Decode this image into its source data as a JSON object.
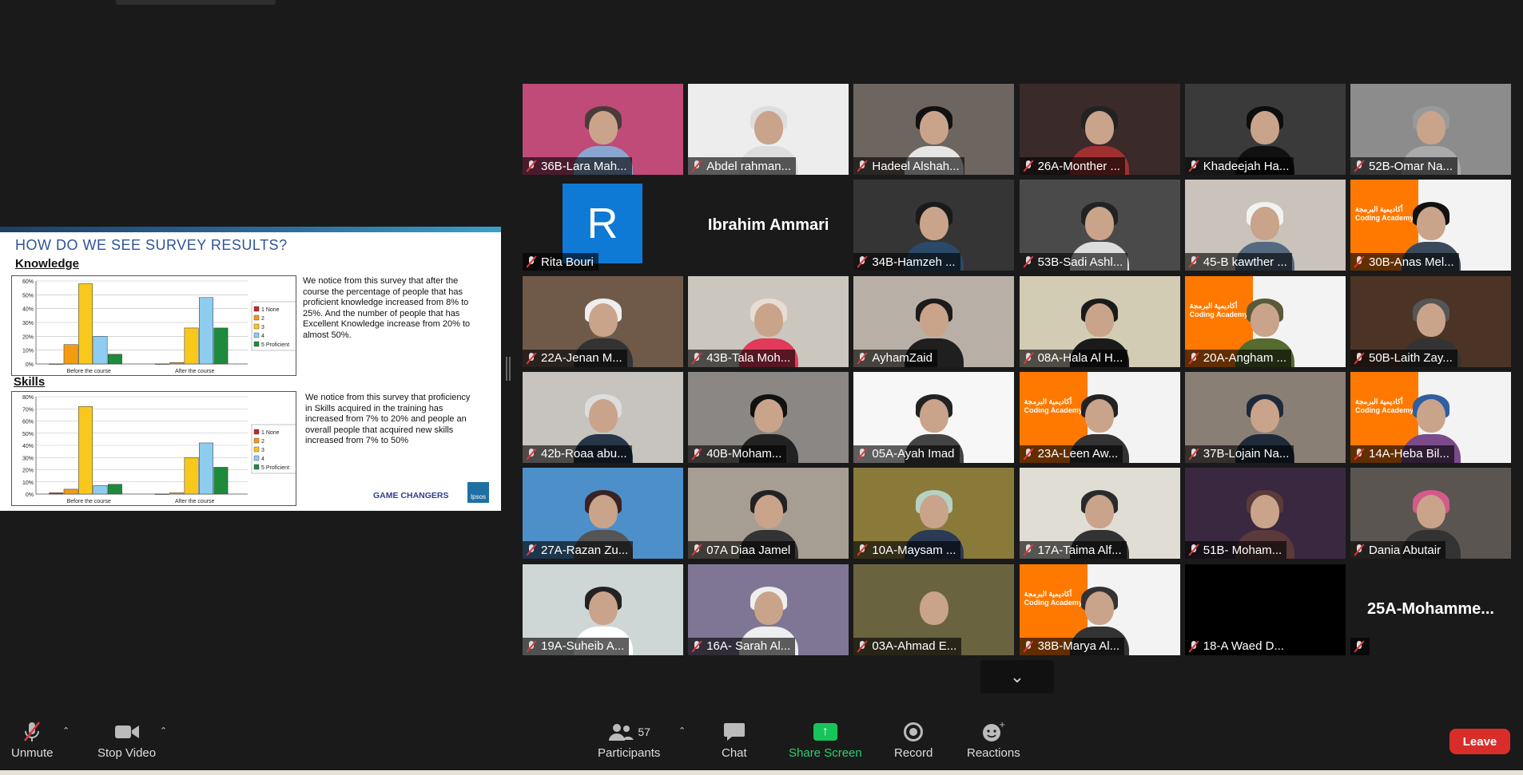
{
  "slide": {
    "title": "HOW DO WE SEE SURVEY RESULTS?",
    "knowledge_heading": "Knowledge",
    "knowledge_text": "We notice from this survey that after the course the percentage of people that has proficient knowledge increased from 8% to 25%. And the number of people that has Excellent Knowledge increase from 20% to almost 50%.",
    "skills_heading": "Skills",
    "skills_text": "We notice from this survey that proficiency in Skills acquired in the training has increased from 7% to 20% and people an overall people that acquired new skills increased from 7% to 50%",
    "brand": "GAME CHANGERS",
    "logo": "Ipsos",
    "legend": [
      "1 None",
      "2",
      "3",
      "4",
      "5 Proficient"
    ],
    "series_colors": [
      "#c0282d",
      "#f39c12",
      "#f8c81c",
      "#8ecdf0",
      "#1e8a3c"
    ],
    "categories": [
      "Before the course",
      "After the course"
    ]
  },
  "chart_data": [
    {
      "type": "bar",
      "title": "Knowledge",
      "categories": [
        "Before the course",
        "After the course"
      ],
      "ylim": [
        0,
        60
      ],
      "yticks": [
        "0%",
        "10%",
        "20%",
        "30%",
        "40%",
        "50%",
        "60%"
      ],
      "series": [
        {
          "name": "1 None",
          "values": [
            0,
            0
          ]
        },
        {
          "name": "2",
          "values": [
            14,
            1
          ]
        },
        {
          "name": "3",
          "values": [
            58,
            26
          ]
        },
        {
          "name": "4",
          "values": [
            20,
            48
          ]
        },
        {
          "name": "5 Proficient",
          "values": [
            7,
            26
          ]
        }
      ]
    },
    {
      "type": "bar",
      "title": "Skills",
      "categories": [
        "Before the course",
        "After the course"
      ],
      "ylim": [
        0,
        80
      ],
      "yticks": [
        "0%",
        "10%",
        "20%",
        "30%",
        "40%",
        "50%",
        "60%",
        "70%",
        "80%"
      ],
      "series": [
        {
          "name": "1 None",
          "values": [
            1,
            0
          ]
        },
        {
          "name": "2",
          "values": [
            4,
            1
          ]
        },
        {
          "name": "3",
          "values": [
            72,
            30
          ]
        },
        {
          "name": "4",
          "values": [
            7,
            42
          ]
        },
        {
          "name": "5 Proficient",
          "values": [
            8,
            22
          ]
        }
      ]
    }
  ],
  "participants": [
    {
      "name": "36B-Lara Mah...",
      "bg": "#c04a78",
      "hair": "#4a3b3b",
      "shirt": "#8aa6d0"
    },
    {
      "name": "Abdel rahman...",
      "bg": "#ededed",
      "hair": "#ddd",
      "shirt": "#ddd"
    },
    {
      "name": "Hadeel Alshah...",
      "bg": "#6d6560",
      "hair": "#111",
      "shirt": "#e5e5e5"
    },
    {
      "name": "26A-Monther ...",
      "bg": "#3a2a2a",
      "hair": "#222",
      "shirt": "#a03030"
    },
    {
      "name": "Khadeejah Ha...",
      "bg": "#3a3a3a",
      "hair": "#0d0d0d",
      "shirt": "#111"
    },
    {
      "name": "52B-Omar Na...",
      "bg": "#8c8c8c",
      "hair": "#999",
      "shirt": "#aaa"
    },
    {
      "name": "Rita Bouri",
      "bg": "#1a1a1a",
      "avatar": "R"
    },
    {
      "name": "Ibrahim Ammari",
      "bg": "#1a1a1a",
      "bigname": true
    },
    {
      "name": "34B-Hamzeh ...",
      "bg": "#353535",
      "hair": "#1a1a1a",
      "shirt": "#2b4a6a"
    },
    {
      "name": "53B-Sadi Ashl...",
      "bg": "#4a4a4a",
      "hair": "#222",
      "shirt": "#ddd"
    },
    {
      "name": "45-B kawther ...",
      "bg": "#c9c3bb",
      "hair": "#f2f2f2",
      "shirt": "#556a80"
    },
    {
      "name": "30B-Anas Mel...",
      "bg": "#f3f3f3",
      "hair": "#111",
      "shirt": "#3b4a5b",
      "orange": true
    },
    {
      "name": "22A-Jenan M...",
      "bg": "#6f5a4a",
      "hair": "#eee",
      "shirt": "#333"
    },
    {
      "name": "43B-Tala Moh...",
      "bg": "#cbc7bf",
      "hair": "#e7ddd3",
      "shirt": "#e23a5a"
    },
    {
      "name": "AyhamZaid",
      "bg": "#b8b0a6",
      "hair": "#1b1b1b",
      "shirt": "#1f1f1f"
    },
    {
      "name": "08A-Hala Al H...",
      "bg": "#d1ccb3",
      "hair": "#1a1a1a",
      "shirt": "#1a1a1a"
    },
    {
      "name": "20A-Angham ...",
      "bg": "#f3f3f3",
      "hair": "#5a5a3a",
      "shirt": "#556b2f",
      "orange": true
    },
    {
      "name": "50B-Laith Zay...",
      "bg": "#4b3326",
      "hair": "#555",
      "shirt": "#333"
    },
    {
      "name": "42b-Roaa abu...",
      "bg": "#c7c4bf",
      "hair": "#ddd",
      "shirt": "#263548"
    },
    {
      "name": "40B-Moham...",
      "bg": "#8a8784",
      "hair": "#111",
      "shirt": "#222"
    },
    {
      "name": "05A-Ayah Imad",
      "bg": "#f7f7f7",
      "hair": "#222",
      "shirt": "#444"
    },
    {
      "name": "23A-Leen Aw...",
      "bg": "#f3f3f3",
      "hair": "#222",
      "shirt": "#333",
      "orange": true
    },
    {
      "name": "37B-Lojain Na...",
      "bg": "#8a7f75",
      "hair": "#1e2a3a",
      "shirt": "#1e2a3a"
    },
    {
      "name": "14A-Heba Bil...",
      "bg": "#f3f3f3",
      "hair": "#2f5fa0",
      "shirt": "#7a4a8a",
      "orange": true
    },
    {
      "name": "27A-Razan Zu...",
      "bg": "#4d8fc9",
      "hair": "#3a2323",
      "shirt": "#555"
    },
    {
      "name": "07A Diaa Jamel",
      "bg": "#a69e92",
      "hair": "#222",
      "shirt": "#333"
    },
    {
      "name": "10A-Maysam ...",
      "bg": "#8a7a3a",
      "hair": "#b7d0c4",
      "shirt": "#2b3a55"
    },
    {
      "name": "17A-Taima Alf...",
      "bg": "#e0ddd5",
      "hair": "#2a2a2a",
      "shirt": "#333"
    },
    {
      "name": "51B- Moham...",
      "bg": "#3a2840",
      "hair": "#5a3a3a",
      "shirt": "#5a3a3a"
    },
    {
      "name": "Dania Abutair",
      "bg": "#5a5550",
      "hair": "#d35a8a",
      "shirt": "#333"
    },
    {
      "name": "19A-Suheib A...",
      "bg": "#cfd6d6",
      "hair": "#222",
      "shirt": "#ffffff"
    },
    {
      "name": "16A- Sarah Al...",
      "bg": "#7f7696",
      "hair": "#eee",
      "shirt": "#eee"
    },
    {
      "name": "03A-Ahmad E...",
      "bg": "#6a6340",
      "hair": "#6a6340",
      "shirt": "#6a6340"
    },
    {
      "name": "38B-Marya Al...",
      "bg": "#f3f3f3",
      "hair": "#333",
      "shirt": "#333",
      "orange": true
    },
    {
      "name": "18-A Waed D...",
      "bg": "#000000",
      "empty": true
    },
    {
      "name": "25A-Mohamme...",
      "bg": "#1a1a1a",
      "bigname": true,
      "tagless": true
    }
  ],
  "orange_brand": [
    "أكاديمية البرمجة",
    "Coding Academy"
  ],
  "toolbar": {
    "unmute": "Unmute",
    "stop_video": "Stop Video",
    "participants": "Participants",
    "participants_count": "57",
    "chat": "Chat",
    "share_screen": "Share Screen",
    "record": "Record",
    "reactions": "Reactions",
    "leave": "Leave"
  }
}
